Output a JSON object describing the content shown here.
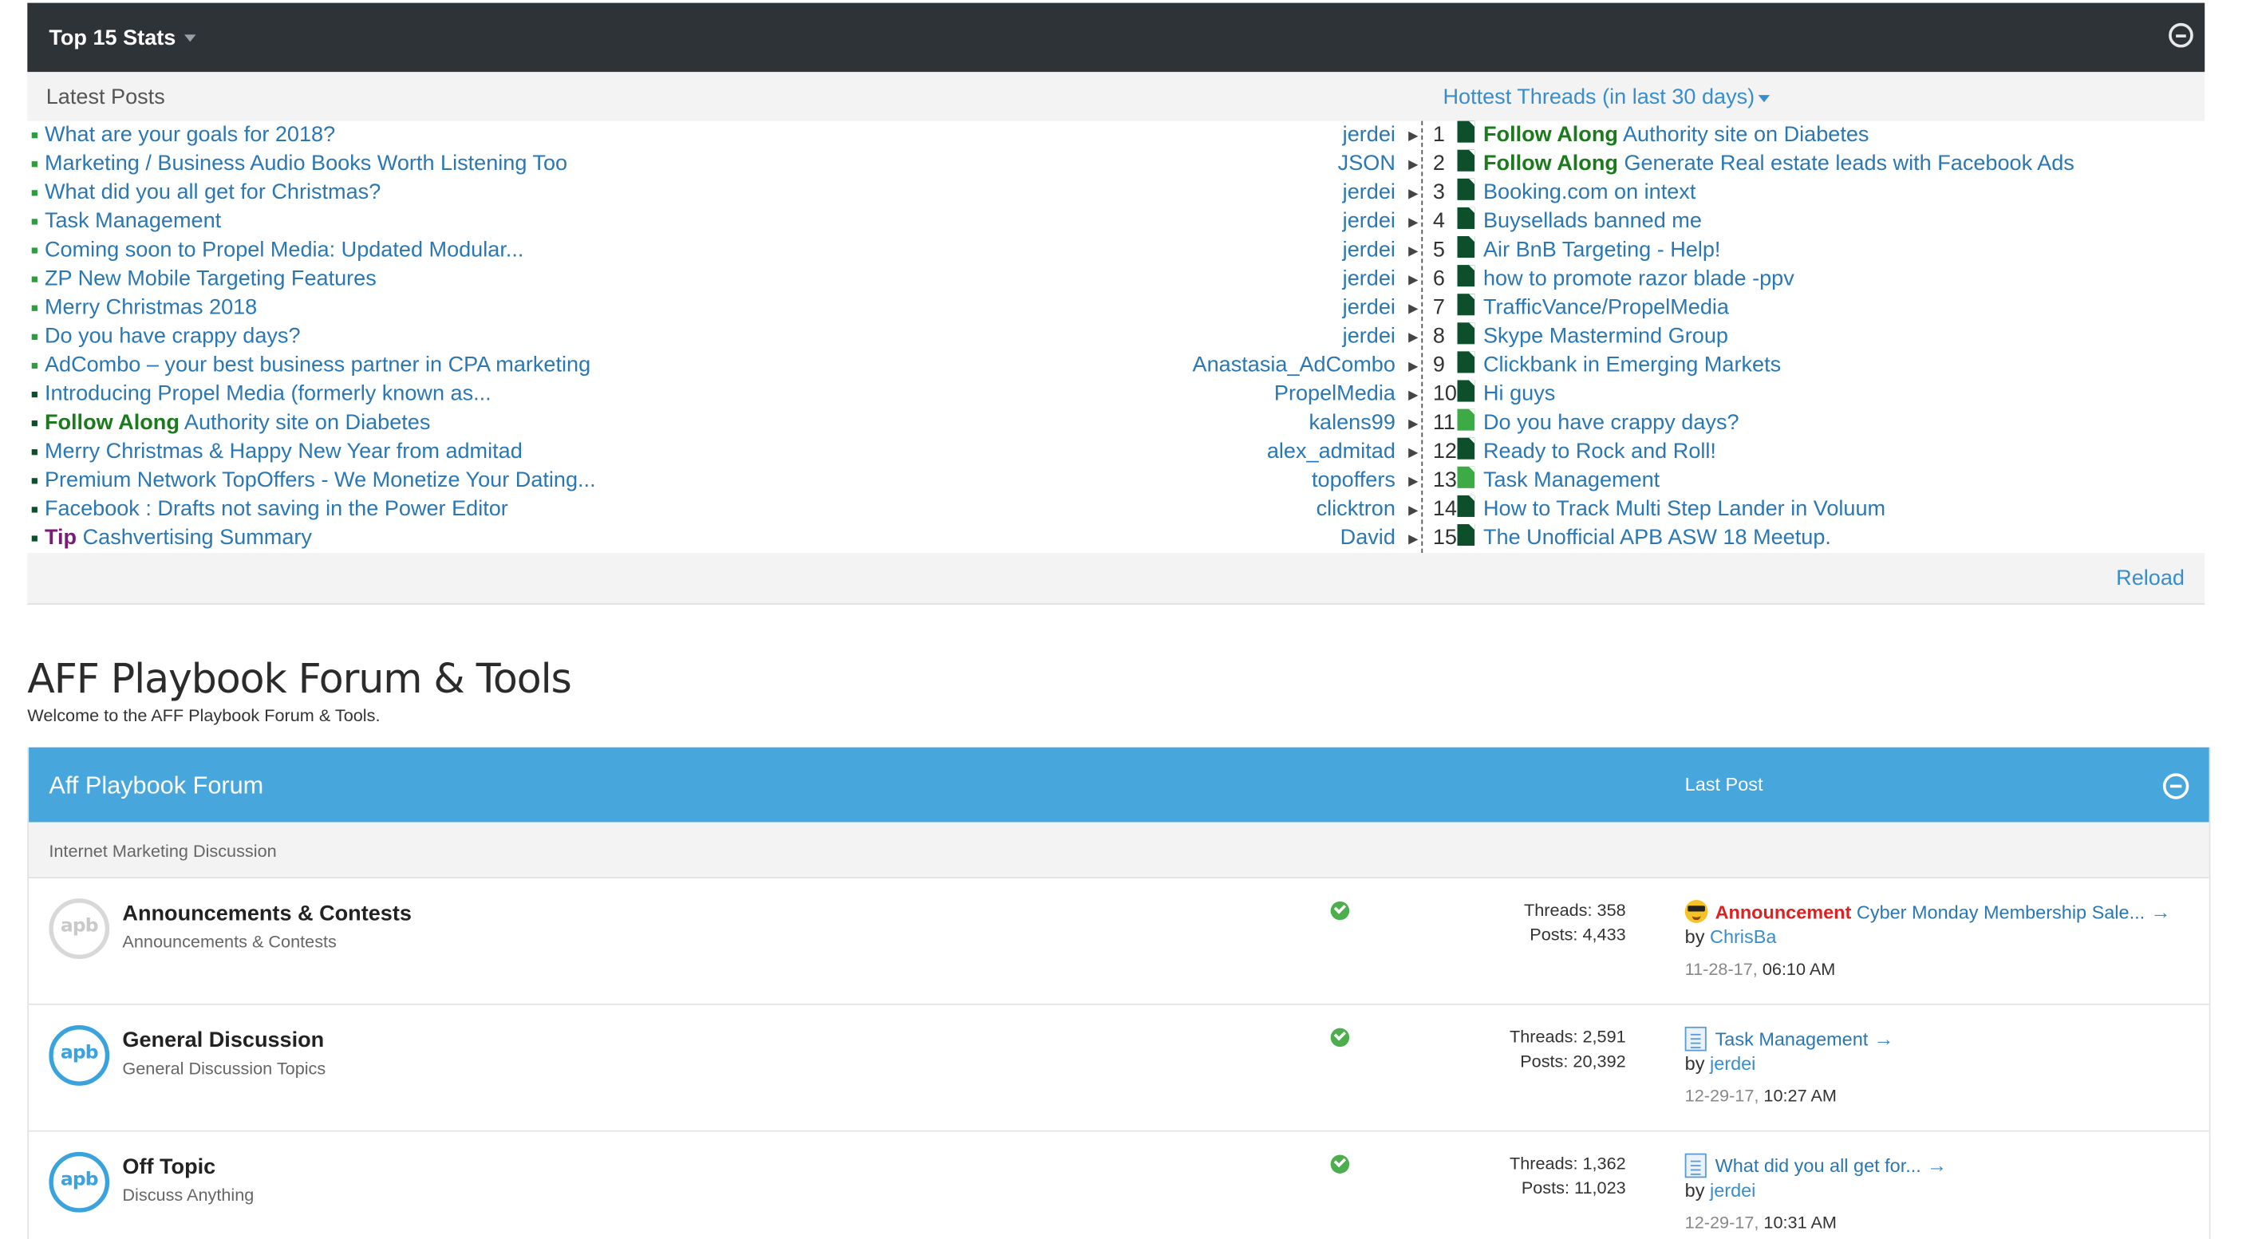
{
  "stats": {
    "title": "Top 15 Stats",
    "latest_label": "Latest Posts",
    "hottest_label": "Hottest Threads (in last 30 days)",
    "reload_label": "Reload",
    "latest_posts": [
      {
        "prefix": "",
        "title": "What are your goals for 2018?",
        "user": "jerdei"
      },
      {
        "prefix": "",
        "title": "Marketing / Business Audio Books Worth Listening Too",
        "user": "JSON"
      },
      {
        "prefix": "",
        "title": "What did you all get for Christmas?",
        "user": "jerdei"
      },
      {
        "prefix": "",
        "title": "Task Management",
        "user": "jerdei"
      },
      {
        "prefix": "",
        "title": "Coming soon to Propel Media: Updated Modular...",
        "user": "jerdei"
      },
      {
        "prefix": "",
        "title": "ZP New Mobile Targeting Features",
        "user": "jerdei"
      },
      {
        "prefix": "",
        "title": "Merry Christmas 2018",
        "user": "jerdei"
      },
      {
        "prefix": "",
        "title": "Do you have crappy days?",
        "user": "jerdei"
      },
      {
        "prefix": "",
        "title": "AdCombo – your best business partner in CPA marketing",
        "user": "Anastasia_AdCombo"
      },
      {
        "prefix": "",
        "title": "Introducing Propel Media (formerly known as...",
        "user": "PropelMedia"
      },
      {
        "prefix": "Follow Along",
        "title": "Authority site on Diabetes",
        "user": "kalens99"
      },
      {
        "prefix": "",
        "title": "Merry Christmas & Happy New Year from admitad",
        "user": "alex_admitad"
      },
      {
        "prefix": "",
        "title": "Premium Network TopOffers - We Monetize Your Dating...",
        "user": "topoffers"
      },
      {
        "prefix": "",
        "title": "Facebook : Drafts not saving in the Power Editor",
        "user": "clicktron"
      },
      {
        "prefix": "Tip",
        "title": "Cashvertising Summary",
        "user": "David"
      }
    ],
    "hottest_threads": [
      {
        "num": "1",
        "prefix": "Follow Along",
        "title": "Authority site on Diabetes"
      },
      {
        "num": "2",
        "prefix": "Follow Along",
        "title": "Generate Real estate leads with Facebook Ads"
      },
      {
        "num": "3",
        "prefix": "",
        "title": "Booking.com on intext"
      },
      {
        "num": "4",
        "prefix": "",
        "title": "Buysellads banned me"
      },
      {
        "num": "5",
        "prefix": "",
        "title": "Air BnB Targeting - Help!"
      },
      {
        "num": "6",
        "prefix": "",
        "title": "how to promote razor blade -ppv"
      },
      {
        "num": "7",
        "prefix": "",
        "title": "TrafficVance/PropelMedia"
      },
      {
        "num": "8",
        "prefix": "",
        "title": "Skype Mastermind Group"
      },
      {
        "num": "9",
        "prefix": "",
        "title": "Clickbank in Emerging Markets"
      },
      {
        "num": "10",
        "prefix": "",
        "title": "Hi guys"
      },
      {
        "num": "11",
        "prefix": "",
        "title": "Do you have crappy days?"
      },
      {
        "num": "12",
        "prefix": "",
        "title": "Ready to Rock and Roll!"
      },
      {
        "num": "13",
        "prefix": "",
        "title": "Task Management"
      },
      {
        "num": "14",
        "prefix": "",
        "title": "How to Track Multi Step Lander in Voluum"
      },
      {
        "num": "15",
        "prefix": "",
        "title": "The Unofficial APB ASW 18 Meetup."
      }
    ]
  },
  "forum": {
    "title": "AFF Playbook Forum & Tools",
    "description": "Welcome to the AFF Playbook Forum & Tools.",
    "category_title": "Aff Playbook Forum",
    "last_post_header": "Last Post",
    "subheading": "Internet Marketing Discussion",
    "nodes": [
      {
        "logo": "apb",
        "name": "Announcements & Contests",
        "desc": "Announcements & Contests",
        "threads": "Threads: 358",
        "posts": "Posts: 4,433",
        "last_prefix": "Announcement",
        "last_title": "Cyber Monday Membership Sale...",
        "by_label": "by",
        "last_user": "ChrisBa",
        "last_date": "11-28-17,",
        "last_time": "06:10 AM"
      },
      {
        "logo": "apb",
        "name": "General Discussion",
        "desc": "General Discussion Topics",
        "threads": "Threads: 2,591",
        "posts": "Posts: 20,392",
        "last_prefix": "",
        "last_title": "Task Management",
        "by_label": "by",
        "last_user": "jerdei",
        "last_date": "12-29-17,",
        "last_time": "10:27 AM"
      },
      {
        "logo": "apb",
        "name": "Off Topic",
        "desc": "Discuss Anything",
        "threads": "Threads: 1,362",
        "posts": "Posts: 11,023",
        "last_prefix": "",
        "last_title": "What did you all get for...",
        "by_label": "by",
        "last_user": "jerdei",
        "last_date": "12-29-17,",
        "last_time": "10:31 AM"
      }
    ]
  },
  "colors": {
    "stats_header_bg": "#2e3338",
    "forum_header_bg": "#47a7dd",
    "link": "#2a77b3",
    "prefix_follow_along": "#1b7a1b",
    "prefix_tip": "#7a1a7a",
    "prefix_announcement": "#e02020"
  },
  "icons": {
    "collapse": "minus-circle-icon",
    "thread_hot": "document-icon",
    "online": "check-circle-icon",
    "go_to_post": "arrow-right-icon"
  }
}
